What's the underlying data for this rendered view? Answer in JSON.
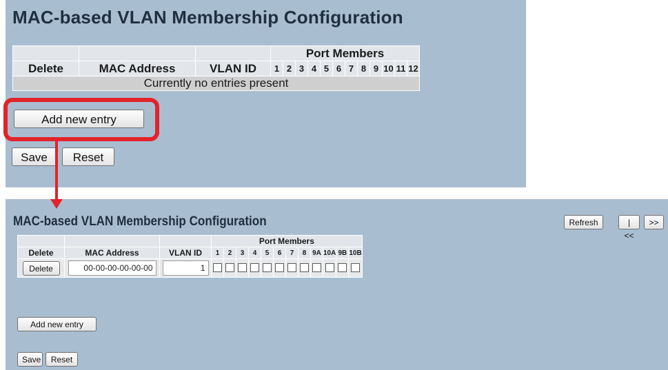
{
  "top": {
    "title": "MAC-based VLAN Membership Configuration",
    "port_members_label": "Port Members",
    "columns": {
      "delete": "Delete",
      "mac": "MAC Address",
      "vlan": "VLAN ID"
    },
    "ports": [
      "1",
      "2",
      "3",
      "4",
      "5",
      "6",
      "7",
      "8",
      "9",
      "10",
      "11",
      "12"
    ],
    "empty_message": "Currently no entries present",
    "add_button": "Add new entry",
    "save_button": "Save",
    "reset_button": "Reset"
  },
  "bottom": {
    "title": "MAC-based VLAN Membership Configuration",
    "nav_buttons": {
      "refresh": "Refresh",
      "first": "|<<",
      "next": ">>"
    },
    "port_members_label": "Port Members",
    "columns": {
      "delete": "Delete",
      "mac": "MAC Address",
      "vlan": "VLAN ID"
    },
    "ports": [
      "1",
      "2",
      "3",
      "4",
      "5",
      "6",
      "7",
      "8",
      "9A",
      "10A",
      "9B",
      "10B"
    ],
    "row": {
      "delete_button": "Delete",
      "mac_value": "00-00-00-00-00-00",
      "vlan_value": "1"
    },
    "add_button": "Add new entry",
    "save_button": "Save",
    "reset_button": "Reset"
  },
  "annotation": {
    "color": "#e2232a"
  }
}
